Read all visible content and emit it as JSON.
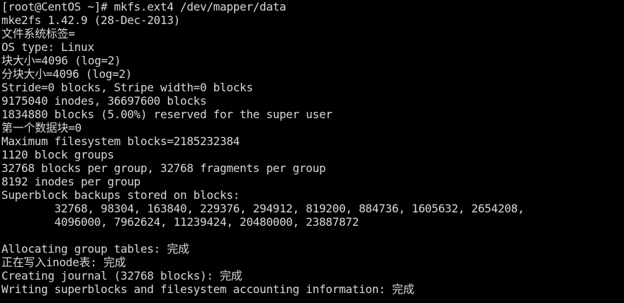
{
  "terminal": {
    "fg_color": "#d8d8d8",
    "bg_color": "#000000",
    "lines": [
      "[root@CentOS ~]# mkfs.ext4 /dev/mapper/data",
      "mke2fs 1.42.9 (28-Dec-2013)",
      "文件系统标签=",
      "OS type: Linux",
      "块大小=4096 (log=2)",
      "分块大小=4096 (log=2)",
      "Stride=0 blocks, Stripe width=0 blocks",
      "9175040 inodes, 36697600 blocks",
      "1834880 blocks (5.00%) reserved for the super user",
      "第一个数据块=0",
      "Maximum filesystem blocks=2185232384",
      "1120 block groups",
      "32768 blocks per group, 32768 fragments per group",
      "8192 inodes per group",
      "Superblock backups stored on blocks:",
      "        32768, 98304, 163840, 229376, 294912, 819200, 884736, 1605632, 2654208,",
      "        4096000, 7962624, 11239424, 20480000, 23887872",
      "",
      "Allocating group tables: 完成",
      "正在写入inode表: 完成",
      "Creating journal (32768 blocks): 完成",
      "Writing superblocks and filesystem accounting information: 完成"
    ]
  }
}
